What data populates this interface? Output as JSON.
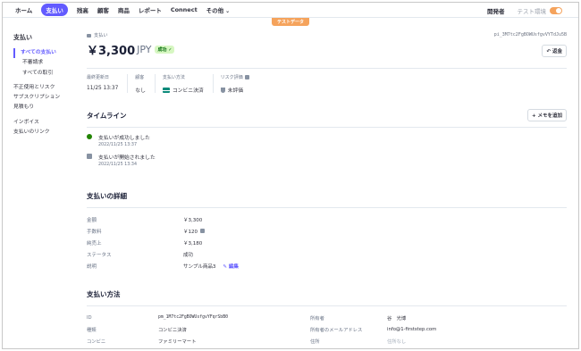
{
  "topnav": {
    "items": [
      "ホーム",
      "支払い",
      "残高",
      "顧客",
      "商品",
      "レポート",
      "Connect",
      "その他"
    ],
    "developer": "開発者",
    "test_mode": "テスト環境",
    "test_banner": "テストデータ"
  },
  "sidebar": {
    "title": "支払い",
    "items": [
      "すべての支払い",
      "不審請求",
      "すべての取引",
      "不正使用とリスク",
      "サブスクリプション",
      "見積もり",
      "インボイス",
      "支払いのリンク"
    ]
  },
  "header": {
    "breadcrumb": "支払い",
    "payment_id_short": "pi_3M7tc2FgBOWUsfgvVYTdJu5B",
    "amount": "￥3,300",
    "currency": "JPY",
    "status_badge": "成功",
    "refund_button": "返金"
  },
  "meta": {
    "last_updated_label": "最終更新日",
    "last_updated_value": "11/25 13:37",
    "customer_label": "顧客",
    "customer_value": "なし",
    "payment_method_label": "支払い方法",
    "payment_method_value": "コンビニ決済",
    "risk_label": "リスク評価",
    "risk_value": "未評価"
  },
  "timeline": {
    "title": "タイムライン",
    "add_note": "メモを追加",
    "events": [
      {
        "title": "支払いが成功しました",
        "time": "2022/11/25 13:37"
      },
      {
        "title": "支払いが開始されました",
        "time": "2022/11/25 13:34"
      }
    ]
  },
  "details": {
    "title": "支払いの詳細",
    "rows": [
      {
        "key": "金額",
        "value": "￥3,300"
      },
      {
        "key": "手数料",
        "value": "￥120"
      },
      {
        "key": "純売上",
        "value": "￥3,180"
      },
      {
        "key": "ステータス",
        "value": "成功"
      },
      {
        "key": "説明",
        "value": "サンプル商品3"
      }
    ],
    "edit": "編集"
  },
  "payment_method": {
    "title": "支払い方法",
    "left": [
      {
        "key": "ID",
        "value": "pm_1M7tc2FgBOWUsfgvYFqrSbB0"
      },
      {
        "key": "種類",
        "value": "コンビニ決済"
      },
      {
        "key": "コンビニ",
        "value": "ファミリーマート"
      }
    ],
    "right": [
      {
        "key": "所有者",
        "value": "谷　光博"
      },
      {
        "key": "所有者のメールアドレス",
        "value": "info@1-firststep.com"
      },
      {
        "key": "住所",
        "value": "住所なし"
      }
    ]
  }
}
